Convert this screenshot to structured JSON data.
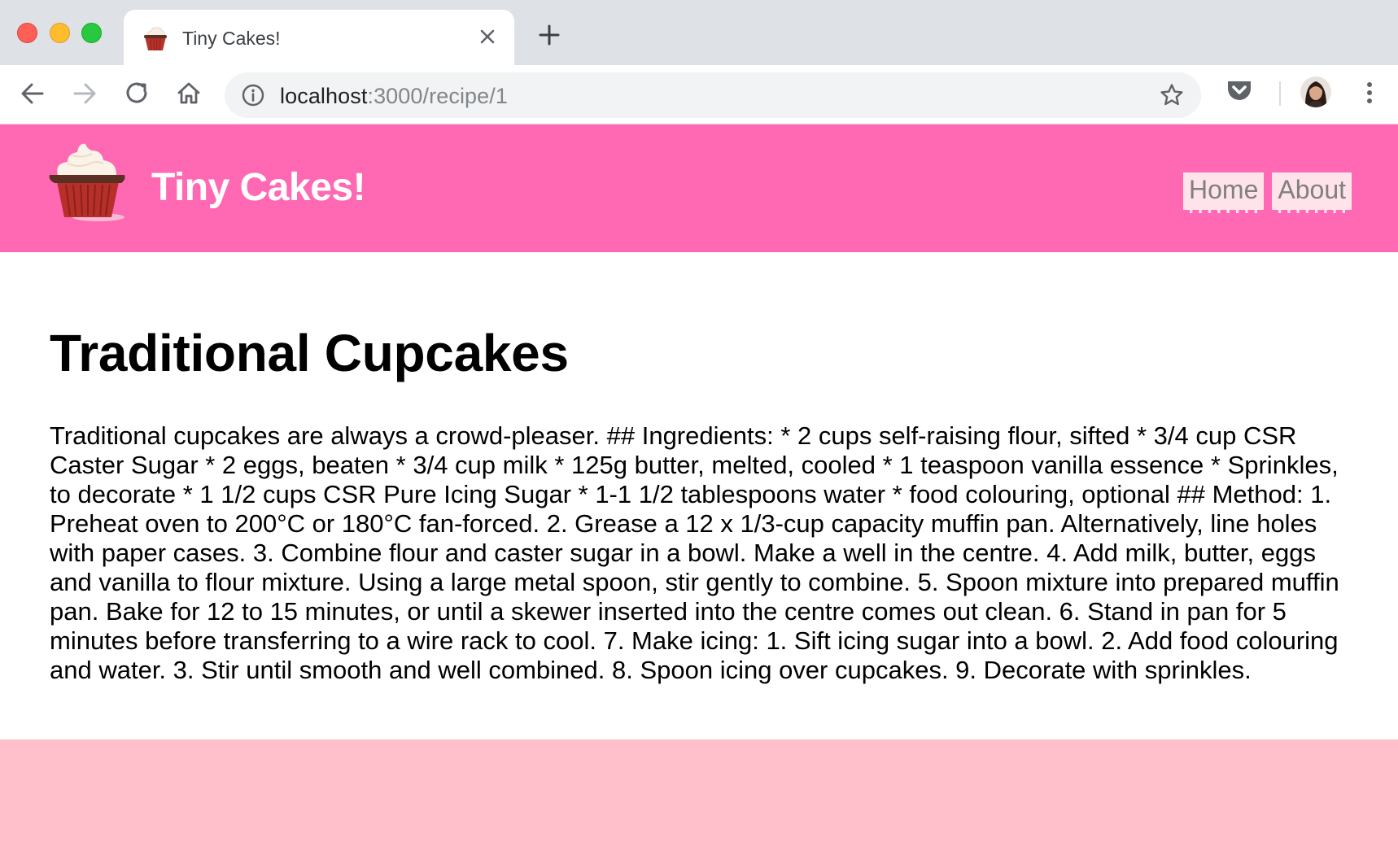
{
  "browser": {
    "tab": {
      "title": "Tiny Cakes!",
      "favicon": "cupcake-icon"
    },
    "address_bar": {
      "host": "localhost",
      "path": ":3000/recipe/1"
    },
    "icons": {
      "back": "arrow-left-icon",
      "forward": "arrow-right-icon",
      "reload": "reload-icon",
      "home": "home-icon",
      "info": "info-icon",
      "bookmark": "star-icon",
      "pocket": "pocket-icon",
      "menu": "kebab-menu-icon"
    }
  },
  "site": {
    "brand": "Tiny Cakes!",
    "logo": "cupcake-logo",
    "nav": [
      {
        "label": "Home"
      },
      {
        "label": "About"
      }
    ],
    "colors": {
      "header": "#ff69b4",
      "footer": "#ffc0cb",
      "nav_link_bg": "#ffe3ea"
    }
  },
  "recipe": {
    "title": "Traditional Cupcakes",
    "body": "Traditional cupcakes are always a crowd-pleaser. ## Ingredients: * 2 cups self-raising flour, sifted * 3/4 cup CSR Caster Sugar * 2 eggs, beaten * 3/4 cup milk * 125g butter, melted, cooled * 1 teaspoon vanilla essence * Sprinkles, to decorate * 1 1/2 cups CSR Pure Icing Sugar * 1-1 1/2 tablespoons water * food colouring, optional ## Method: 1. Preheat oven to 200°C or 180°C fan-forced. 2. Grease a 12 x 1/3-cup capacity muffin pan. Alternatively, line holes with paper cases. 3. Combine flour and caster sugar in a bowl. Make a well in the centre. 4. Add milk, butter, eggs and vanilla to flour mixture. Using a large metal spoon, stir gently to combine. 5. Spoon mixture into prepared muffin pan. Bake for 12 to 15 minutes, or until a skewer inserted into the centre comes out clean. 6. Stand in pan for 5 minutes before transferring to a wire rack to cool. 7. Make icing: 1. Sift icing sugar into a bowl. 2. Add food colouring and water. 3. Stir until smooth and well combined. 8. Spoon icing over cupcakes. 9. Decorate with sprinkles."
  }
}
